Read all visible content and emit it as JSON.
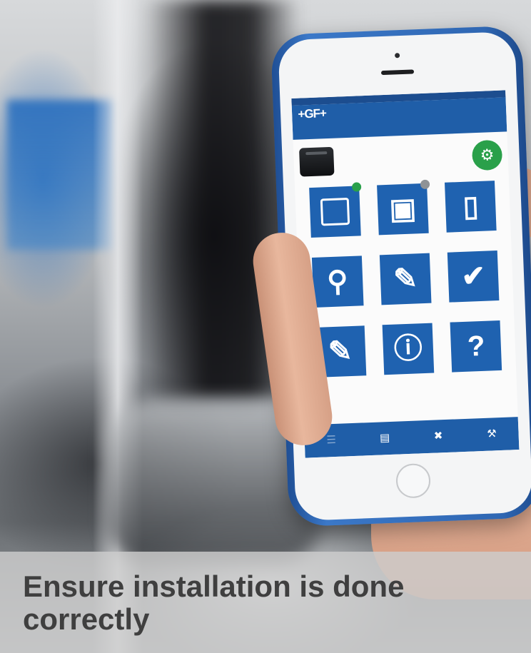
{
  "caption": {
    "headline": "Ensure installation is done correctly"
  },
  "app": {
    "logo": "+GF+",
    "icons": {
      "status": "worker-icon",
      "tiles": [
        "chat-icon",
        "camera-icon",
        "device-icon",
        "location-icon",
        "edit-icon",
        "badge-check-icon",
        "edit-icon",
        "info-icon",
        "question-icon"
      ],
      "nav": [
        "menu-icon",
        "clipboard-icon",
        "tools-icon",
        "wrench-icon"
      ]
    },
    "colors": {
      "primary": "#1f5ea8",
      "tile": "#1f62b0",
      "status_ok": "#2aa04a",
      "phone_case": "#2f67b3"
    }
  }
}
